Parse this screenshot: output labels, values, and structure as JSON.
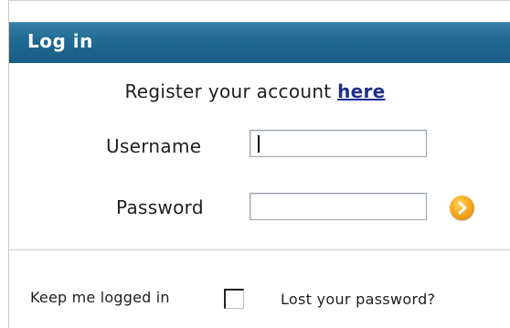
{
  "login": {
    "header_title": "Log in",
    "register_prefix": "Register your account ",
    "register_link": "here",
    "username_label": "Username",
    "username_value": "",
    "password_label": "Password",
    "password_value": "",
    "submit_icon": "arrow-right-icon",
    "keep_logged_in_label": "Keep me logged in",
    "keep_logged_in_checked": false,
    "lost_password_label": "Lost your password?"
  },
  "colors": {
    "header": "#1f6a93",
    "link": "#1e2f8e",
    "submit_button": "#f3a21b"
  }
}
